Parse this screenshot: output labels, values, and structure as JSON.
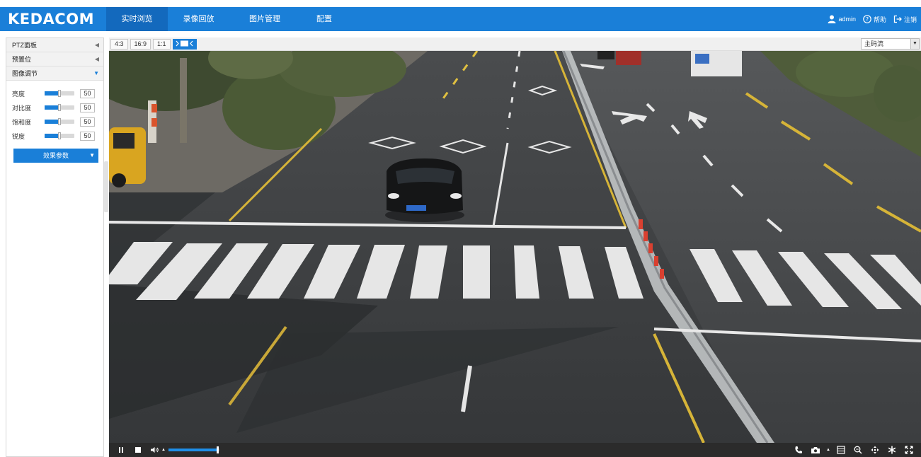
{
  "app": {
    "logo": "KEDACOM"
  },
  "nav": {
    "tabs": [
      {
        "label": "实时浏览",
        "active": true
      },
      {
        "label": "录像回放",
        "active": false
      },
      {
        "label": "图片管理",
        "active": false
      },
      {
        "label": "配置",
        "active": false
      }
    ]
  },
  "header": {
    "user": "admin",
    "help": "帮助",
    "logout": "注销",
    "icons": [
      "user-icon",
      "help-icon",
      "logout-icon"
    ]
  },
  "sidebar": {
    "panels": [
      {
        "label": "PTZ面板",
        "expanded": false
      },
      {
        "label": "预置位",
        "expanded": false
      },
      {
        "label": "图像调节",
        "expanded": true
      }
    ],
    "adjustments": [
      {
        "label": "亮度",
        "value": "50",
        "percent": 50
      },
      {
        "label": "对比度",
        "value": "50",
        "percent": 50
      },
      {
        "label": "饱和度",
        "value": "50",
        "percent": 50
      },
      {
        "label": "锐度",
        "value": "50",
        "percent": 50
      }
    ],
    "effect_button": "效果参数"
  },
  "video_toolbar": {
    "ratios": [
      "4:3",
      "16:9",
      "1:1"
    ],
    "stream": "主码流"
  },
  "player": {
    "volume_percent": 95,
    "left_icons": [
      "pause-icon",
      "stop-icon",
      "volume-icon"
    ],
    "right_icons": [
      "call-icon",
      "snapshot-icon",
      "record-icon",
      "zoom-icon",
      "move-icon",
      "ptz-icon",
      "fullscreen-icon"
    ]
  },
  "colors": {
    "accent": "#1a7fd8",
    "accent_dark": "#1369bd",
    "control_bar": "#2b2b2b"
  }
}
